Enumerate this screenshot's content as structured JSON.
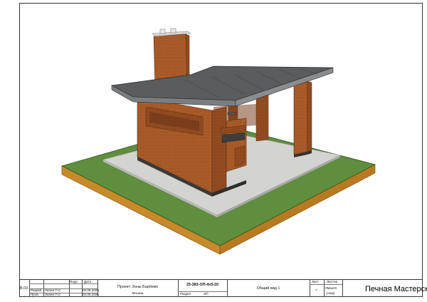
{
  "titleblock": {
    "doc_code_left": "В.03",
    "header_sign": "Подп.",
    "header_date": "Дата",
    "rows": [
      {
        "role": "Разраб",
        "name": "Лапин П.С",
        "date": "03.06.2025"
      },
      {
        "role": "Пров.",
        "name": "Лапин П.С",
        "date": "03.06.2025"
      }
    ],
    "project": "Проект: Зоны Барбекю",
    "city": "Москва",
    "code": "25-383-ОП-4х5-20",
    "section_label": "Раздел",
    "section_value": "ЭП",
    "sheet_title": "Общий вид 1",
    "sheet_label": "Лист",
    "sheet_number": "7",
    "sheets_label": "Листов",
    "sheets_value_1": "#МаxIO",
    "sheets_value_2": "(сокр)",
    "company": "Печная Мастерская"
  },
  "colors": {
    "grass": "#5f8e3e",
    "ground": "#c88a2a",
    "paving": "#d3d3cf",
    "brick": "#b4622c",
    "roof": "#5a5c5e"
  }
}
